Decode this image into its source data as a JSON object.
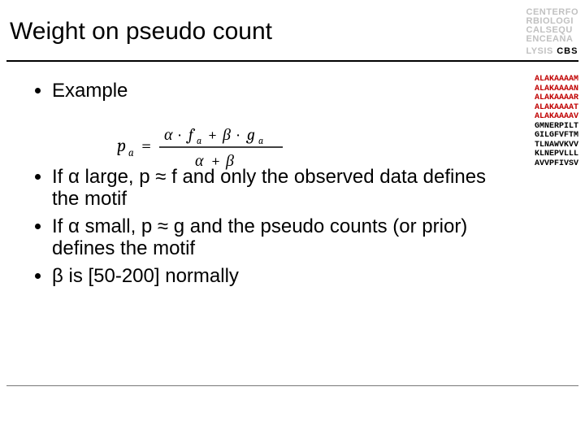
{
  "title": "Weight on pseudo count",
  "logo": {
    "line1": "CENTERFO",
    "line2": "RBIOLOGI",
    "line3": "CALSEQU",
    "line4": "ENCEANA",
    "line5": "LYSIS",
    "cbs": "CBS"
  },
  "bullets": {
    "b1": "Example",
    "b2_pre": "If ",
    "b2_mid": " large, p ≈ f and only the observed data defines the motif",
    "b3_pre": "If ",
    "b3_mid": " small, p ≈ g and the pseudo counts (or prior) defines the motif",
    "b4_mid": " is [50-200] normally",
    "alpha": "α",
    "beta": "β"
  },
  "formula": {
    "pa": "p",
    "pa_sub": "a",
    "eq": "=",
    "alpha1": "α",
    "dot1": "·",
    "fa": "f",
    "fa_sub": "a",
    "plus1": "+",
    "beta1": "β",
    "dot2": "·",
    "ga": "g",
    "ga_sub": "a",
    "alpha2": "α",
    "plus2": "+",
    "beta2": "β"
  },
  "sequences": {
    "s1": "ALAKAAAAM",
    "s2": "ALAKAAAAN",
    "s3": "ALAKAAAAR",
    "s4": "ALAKAAAAT",
    "s5": "ALAKAAAAV",
    "s6": "GMNERPILT",
    "s7": "GILGFVFTM",
    "s8": "TLNAWVKVV",
    "s9": "KLNEPVLLL",
    "s10": "AVVPFIVSV"
  }
}
